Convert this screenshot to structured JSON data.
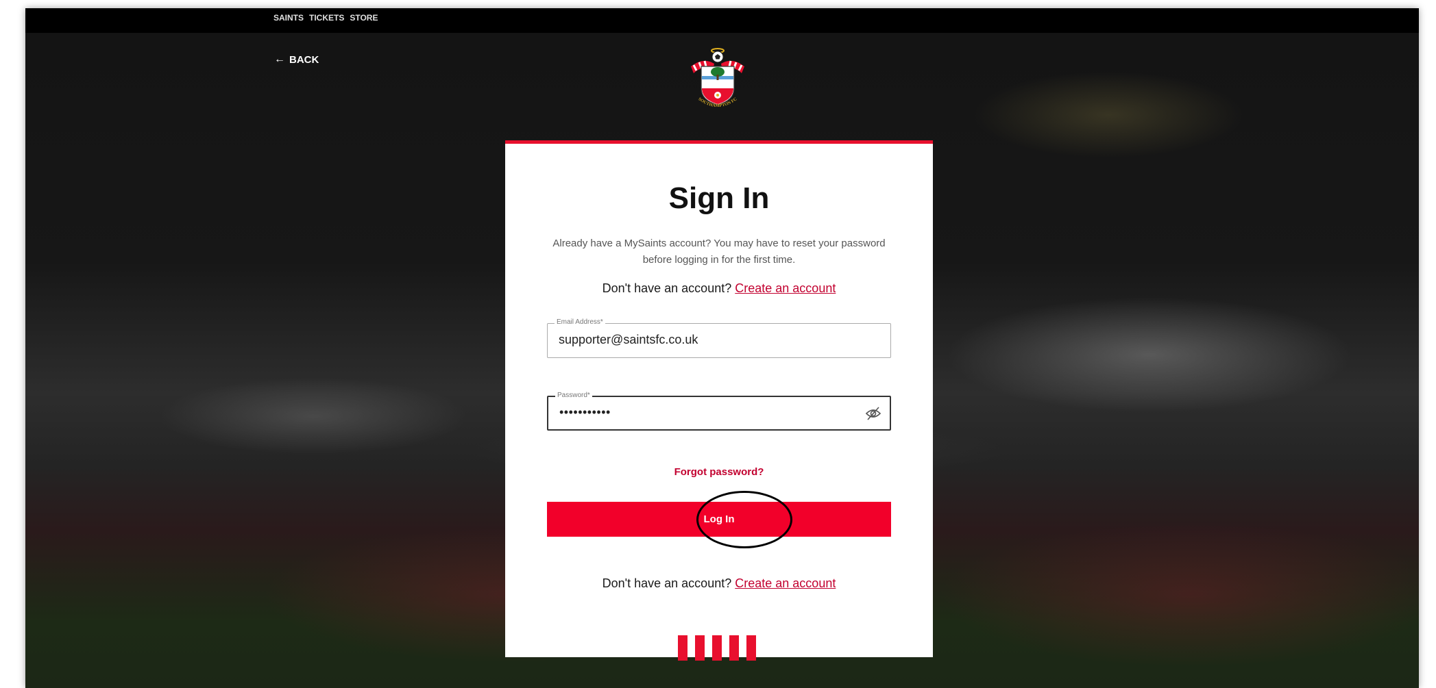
{
  "topnav": {
    "links": [
      "SAINTS",
      "TICKETS",
      "STORE"
    ]
  },
  "back": {
    "arrow": "←",
    "label": "BACK"
  },
  "crest": {
    "icon": "southampton-fc-crest-icon",
    "text": "SOUTHAMPTON FC"
  },
  "signin": {
    "title": "Sign In",
    "intro": "Already have a MySaints account? You may have to reset your password before logging in for the first time.",
    "no_account_text": "Don't have an account?",
    "create_account_link": "Create an account",
    "email": {
      "label": "Email Address*",
      "value": "supporter@saintsfc.co.uk"
    },
    "password": {
      "label": "Password*",
      "value": "•••••••••••",
      "toggle_icon": "eye-slash-icon"
    },
    "forgot_password": "Forgot password?",
    "login_button": "Log In",
    "footer_no_account_text": "Don't have an account?",
    "footer_create_account_link": "Create an account"
  },
  "colors": {
    "accent": "#f2002a",
    "link": "#c2002f",
    "nav_bg": "#000000",
    "card_bg": "#ffffff"
  }
}
